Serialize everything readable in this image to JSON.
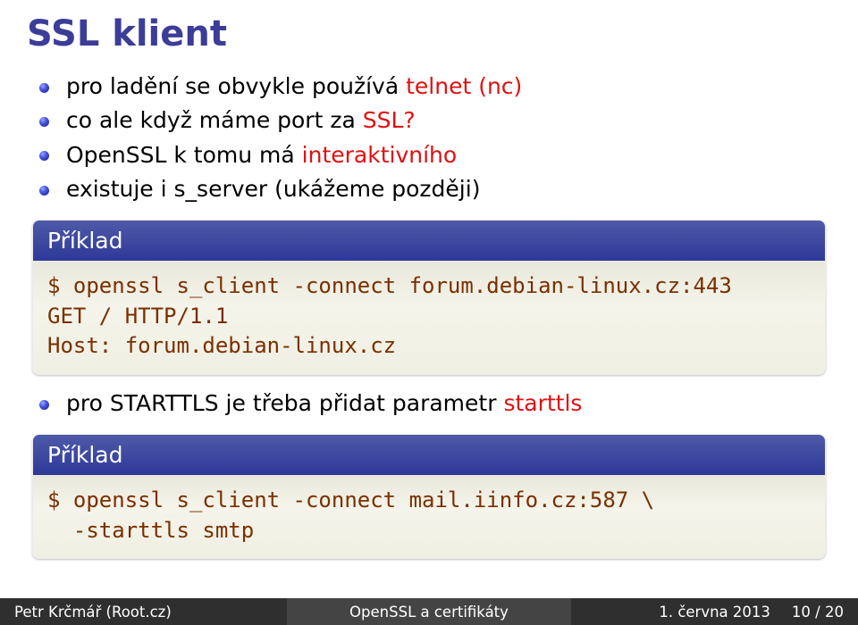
{
  "title": "SSL klient",
  "bullets": {
    "group1": [
      {
        "prefix": "pro ladění se obvykle používá ",
        "hl": "telnet (nc)",
        "suffix": ""
      },
      {
        "prefix": "co ale když máme port za ",
        "hl": "SSL?",
        "suffix": ""
      },
      {
        "prefix": "OpenSSL k tomu má ",
        "hl": "interaktivního",
        "suffix": ""
      },
      {
        "prefix": "existuje i s_server (ukážeme později)",
        "hl": "",
        "suffix": ""
      }
    ],
    "group2": [
      {
        "prefix": "pro STARTTLS je třeba přidat parametr ",
        "hl": "starttls",
        "suffix": ""
      }
    ]
  },
  "example_label": "Příklad",
  "example1_code": "$ openssl s_client -connect forum.debian-linux.cz:443\nGET / HTTP/1.1\nHost: forum.debian-linux.cz",
  "example2_code": "$ openssl s_client -connect mail.iinfo.cz:587 \\\n  -starttls smtp",
  "footer": {
    "left": "Petr Krčmář (Root.cz)",
    "center": "OpenSSL a certifikáty",
    "right_date": "1. června 2013",
    "right_page": "10 / 20"
  }
}
